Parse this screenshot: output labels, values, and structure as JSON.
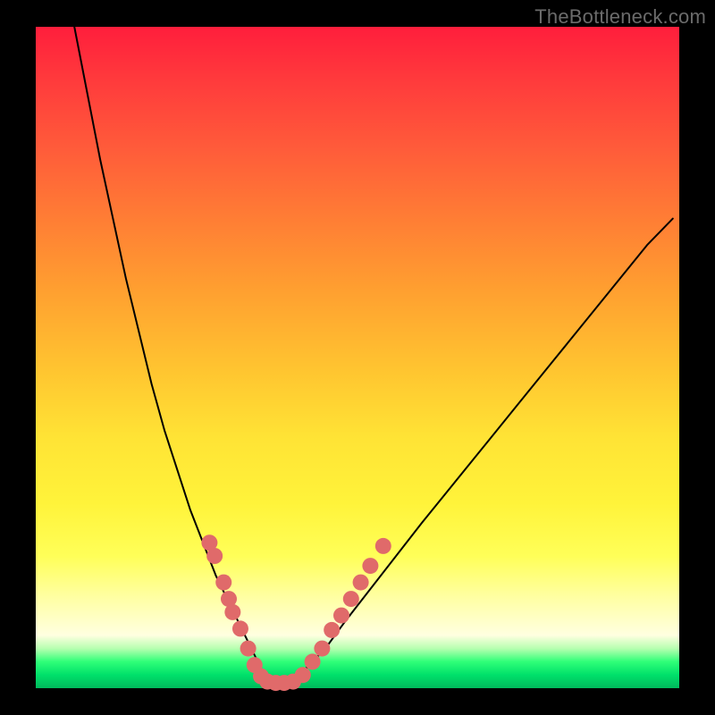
{
  "watermark": "TheBottleneck.com",
  "chart_data": {
    "type": "line",
    "title": "",
    "xlabel": "",
    "ylabel": "",
    "xlim": [
      0,
      100
    ],
    "ylim": [
      0,
      100
    ],
    "grid": false,
    "legend": false,
    "series": [
      {
        "name": "curve-left",
        "stroke": "#000000",
        "x": [
          6,
          8,
          10,
          12,
          14,
          16,
          18,
          20,
          22,
          24,
          26,
          28,
          30,
          32,
          33,
          34,
          35,
          36
        ],
        "y": [
          100,
          90,
          80,
          71,
          62,
          54,
          46,
          39,
          33,
          27,
          22,
          17,
          13,
          9,
          7,
          5,
          3,
          1
        ]
      },
      {
        "name": "curve-right",
        "stroke": "#000000",
        "x": [
          40,
          42,
          45,
          48,
          52,
          56,
          60,
          65,
          70,
          75,
          80,
          85,
          90,
          95,
          99
        ],
        "y": [
          1,
          3,
          6,
          10,
          15,
          20,
          25,
          31,
          37,
          43,
          49,
          55,
          61,
          67,
          71
        ]
      }
    ],
    "markers": [
      {
        "name": "dots-left",
        "fill": "#e06a6a",
        "r": 9,
        "points": [
          {
            "x": 27.0,
            "y": 22.0
          },
          {
            "x": 27.8,
            "y": 20.0
          },
          {
            "x": 29.2,
            "y": 16.0
          },
          {
            "x": 30.0,
            "y": 13.5
          },
          {
            "x": 30.6,
            "y": 11.5
          },
          {
            "x": 31.8,
            "y": 9.0
          },
          {
            "x": 33.0,
            "y": 6.0
          },
          {
            "x": 34.0,
            "y": 3.5
          },
          {
            "x": 35.0,
            "y": 1.8
          },
          {
            "x": 36.0,
            "y": 1.0
          },
          {
            "x": 37.3,
            "y": 0.8
          },
          {
            "x": 38.6,
            "y": 0.8
          },
          {
            "x": 40.0,
            "y": 1.0
          }
        ]
      },
      {
        "name": "dots-right",
        "fill": "#e06a6a",
        "r": 9,
        "points": [
          {
            "x": 41.5,
            "y": 2.0
          },
          {
            "x": 43.0,
            "y": 4.0
          },
          {
            "x": 44.5,
            "y": 6.0
          },
          {
            "x": 46.0,
            "y": 8.8
          },
          {
            "x": 47.5,
            "y": 11.0
          },
          {
            "x": 49.0,
            "y": 13.5
          },
          {
            "x": 50.5,
            "y": 16.0
          },
          {
            "x": 52.0,
            "y": 18.5
          },
          {
            "x": 54.0,
            "y": 21.5
          }
        ]
      }
    ],
    "gradient_stops": [
      {
        "pos": 0,
        "color": "#ff1e3c"
      },
      {
        "pos": 18,
        "color": "#ff5a3a"
      },
      {
        "pos": 40,
        "color": "#ffa030"
      },
      {
        "pos": 62,
        "color": "#ffe335"
      },
      {
        "pos": 80,
        "color": "#ffff58"
      },
      {
        "pos": 92,
        "color": "#ffffe0"
      },
      {
        "pos": 96,
        "color": "#2fff78"
      },
      {
        "pos": 100,
        "color": "#00b95c"
      }
    ]
  }
}
